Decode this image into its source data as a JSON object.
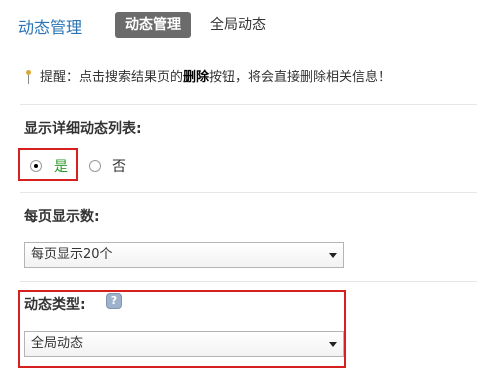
{
  "header": {
    "title": "动态管理",
    "tabs": [
      {
        "label": "动态管理",
        "active": true
      },
      {
        "label": "全局动态",
        "active": false
      }
    ]
  },
  "hint": {
    "prefix": "提醒：点击搜索结果页的",
    "bold": "删除",
    "suffix": "按钮，将会直接删除相关信息！"
  },
  "show_list": {
    "label": "显示详细动态列表:",
    "options": [
      {
        "label": "是",
        "selected": true,
        "color": "#2a9a2a"
      },
      {
        "label": "否",
        "selected": false
      }
    ]
  },
  "per_page": {
    "label": "每页显示数:",
    "value": "每页显示20个"
  },
  "feed_type": {
    "label": "动态类型:",
    "help_icon": "help-icon",
    "value": "全局动态"
  },
  "colors": {
    "accent": "#2a74b5",
    "highlight_border": "#d62020",
    "active_tab_bg": "#6b6b6b"
  }
}
